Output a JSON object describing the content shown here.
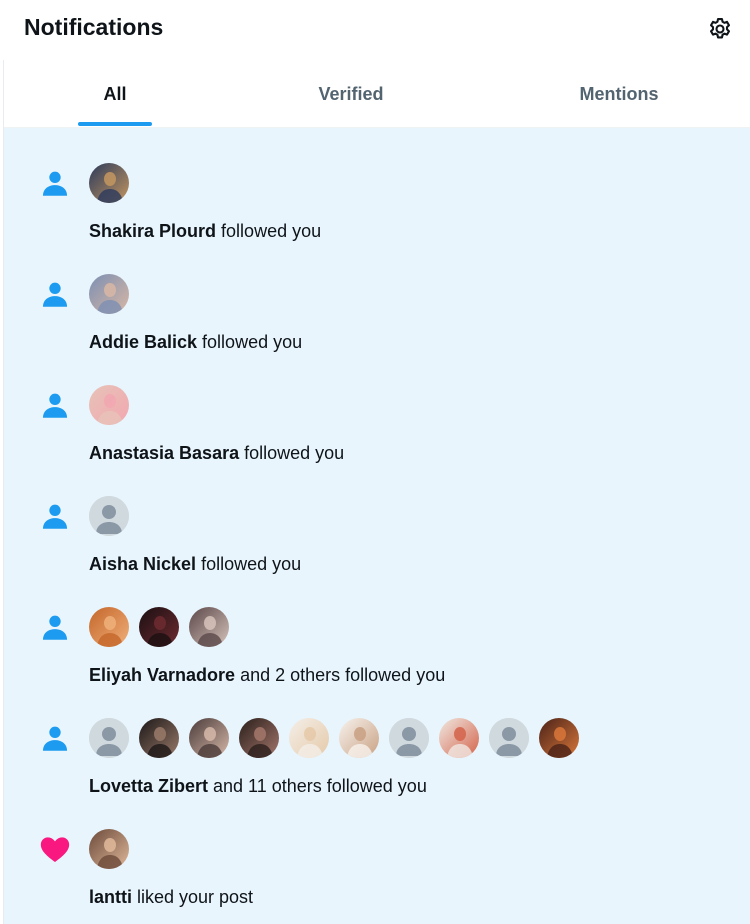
{
  "header": {
    "title": "Notifications",
    "settings_icon": "gear-icon"
  },
  "tabs": [
    {
      "label": "All",
      "active": true
    },
    {
      "label": "Verified",
      "active": false
    },
    {
      "label": "Mentions",
      "active": false
    }
  ],
  "colors": {
    "accent": "#1d9bf0",
    "like": "#f91880",
    "feed_bg": "#e8f5fd",
    "default_avatar": "#cfd9de"
  },
  "notifications": [
    {
      "icon": "person-icon",
      "name": "Shakira Plourd",
      "text": " followed you",
      "avatars": [
        {
          "kind": "photo",
          "c1": "#2b3a5c",
          "c2": "#c4965f"
        }
      ]
    },
    {
      "icon": "person-icon",
      "name": "Addie Balick",
      "text": " followed you",
      "avatars": [
        {
          "kind": "photo",
          "c1": "#7c8fb3",
          "c2": "#d8b7a4"
        }
      ]
    },
    {
      "icon": "person-icon",
      "name": "Anastasia Basara",
      "text": " followed you",
      "avatars": [
        {
          "kind": "photo",
          "c1": "#e7c3b8",
          "c2": "#f2a7b0"
        }
      ]
    },
    {
      "icon": "person-icon",
      "name": "Aisha Nickel",
      "text": " followed you",
      "avatars": [
        {
          "kind": "default"
        }
      ]
    },
    {
      "icon": "person-icon",
      "name": "Eliyah Varnadore",
      "text": " and 2 others followed you",
      "avatars": [
        {
          "kind": "photo",
          "c1": "#c4662a",
          "c2": "#f0b07a"
        },
        {
          "kind": "photo",
          "c1": "#1a0f12",
          "c2": "#6e2b30"
        },
        {
          "kind": "photo",
          "c1": "#5a4748",
          "c2": "#d7c3bb"
        }
      ]
    },
    {
      "icon": "person-icon",
      "name": "Lovetta Zibert",
      "text": " and 11 others followed you",
      "avatars": [
        {
          "kind": "default"
        },
        {
          "kind": "photo",
          "c1": "#1b1717",
          "c2": "#9a7a6a"
        },
        {
          "kind": "photo",
          "c1": "#4b3b3a",
          "c2": "#d6b8a8"
        },
        {
          "kind": "photo",
          "c1": "#2a1e1b",
          "c2": "#a4776b"
        },
        {
          "kind": "photo",
          "c1": "#f4efe9",
          "c2": "#e5c9a8"
        },
        {
          "kind": "photo",
          "c1": "#f7f3ee",
          "c2": "#c9a082"
        },
        {
          "kind": "default"
        },
        {
          "kind": "photo",
          "c1": "#f0e9e3",
          "c2": "#d4634a"
        },
        {
          "kind": "default"
        },
        {
          "kind": "photo",
          "c1": "#4a2218",
          "c2": "#d9773a"
        }
      ]
    },
    {
      "icon": "heart-icon",
      "name": "lantti",
      "text": " liked your post",
      "avatars": [
        {
          "kind": "photo",
          "c1": "#6b4a3a",
          "c2": "#e0b89a"
        }
      ]
    }
  ]
}
